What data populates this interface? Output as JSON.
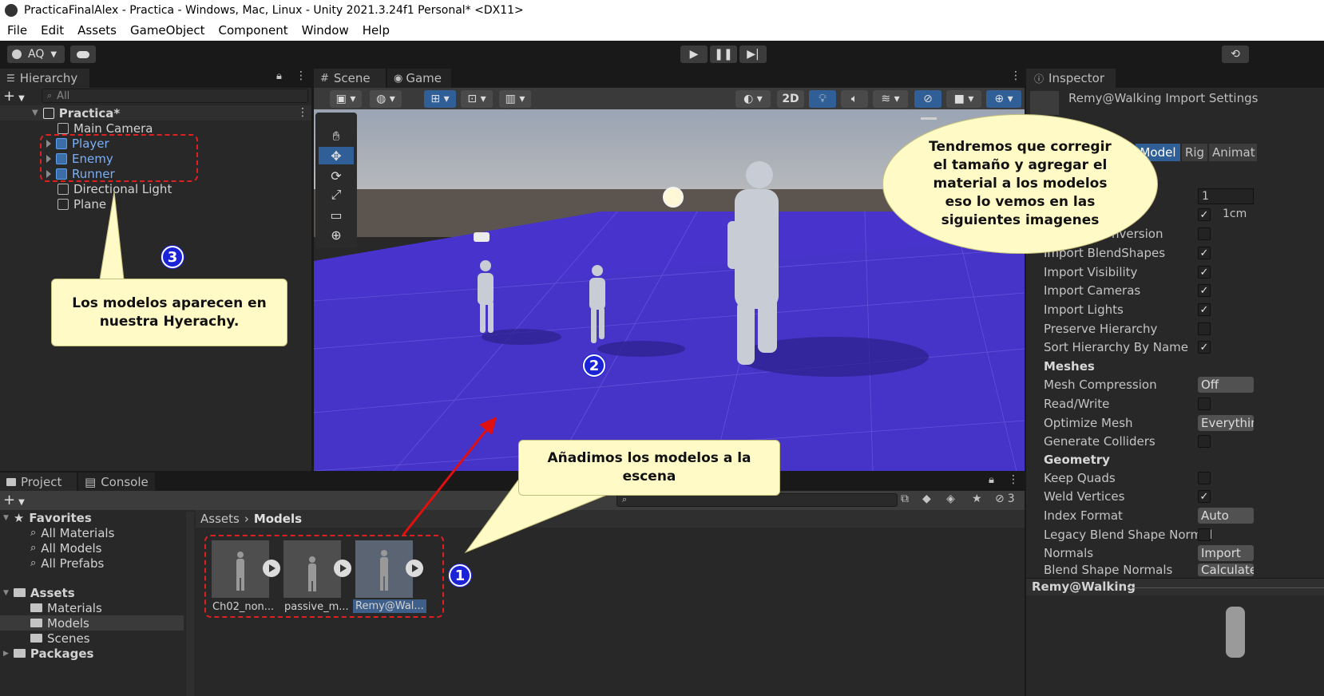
{
  "window": {
    "title": "PracticaFinalAlex - Practica - Windows, Mac, Linux - Unity 2021.3.24f1 Personal* <DX11>"
  },
  "menu": [
    "File",
    "Edit",
    "Assets",
    "GameObject",
    "Component",
    "Window",
    "Help"
  ],
  "toolbar": {
    "account": "AQ"
  },
  "hierarchy": {
    "tab": "Hierarchy",
    "search_placeholder": "All",
    "scene": "Practica*",
    "items": [
      "Main Camera",
      "Player",
      "Enemy",
      "Runner",
      "Directional Light",
      "Plane"
    ]
  },
  "scene_view": {
    "tabs": [
      "Scene",
      "Game"
    ],
    "mode_2d": "2D"
  },
  "inspector": {
    "tab": "Inspector",
    "header": "Remy@Walking Import Settings",
    "subtabs": [
      "Model",
      "Rig",
      "Animat"
    ],
    "scale_value": "1",
    "unit_label": "1cm",
    "partial_row": "nversion",
    "rows": [
      {
        "label": "Import BlendShapes",
        "checked": true
      },
      {
        "label": "Import Visibility",
        "checked": true
      },
      {
        "label": "Import Cameras",
        "checked": true
      },
      {
        "label": "Import Lights",
        "checked": true
      },
      {
        "label": "Preserve Hierarchy",
        "checked": false
      },
      {
        "label": "Sort Hierarchy By Name",
        "checked": true
      }
    ],
    "meshes_header": "Meshes",
    "mesh_compression": {
      "label": "Mesh Compression",
      "value": "Off"
    },
    "read_write": {
      "label": "Read/Write",
      "checked": false
    },
    "optimize_mesh": {
      "label": "Optimize Mesh",
      "value": "Everythin"
    },
    "generate_colliders": {
      "label": "Generate Colliders",
      "checked": false
    },
    "geometry_header": "Geometry",
    "keep_quads": {
      "label": "Keep Quads",
      "checked": false
    },
    "weld_vertices": {
      "label": "Weld Vertices",
      "checked": true
    },
    "index_format": {
      "label": "Index Format",
      "value": "Auto"
    },
    "legacy_blend": {
      "label": "Legacy Blend Shape Normal",
      "checked": false
    },
    "normals": {
      "label": "Normals",
      "value": "Import"
    },
    "blend_shape_normals": {
      "label": "Blend Shape Normals",
      "value": "Calculate"
    },
    "preview_title": "Remy@Walking"
  },
  "project": {
    "tabs": [
      "Project",
      "Console"
    ],
    "hidden_count": "3",
    "breadcrumb": [
      "Assets",
      "Models"
    ],
    "favorites": {
      "label": "Favorites",
      "items": [
        "All Materials",
        "All Models",
        "All Prefabs"
      ]
    },
    "assets": {
      "label": "Assets",
      "items": [
        "Materials",
        "Models",
        "Scenes"
      ]
    },
    "packages": "Packages",
    "files": [
      "Ch02_non...",
      "passive_m...",
      "Remy@Wal..."
    ]
  },
  "callouts": {
    "top_right": "Tendremos que corregir el tamaño y agregar el material a los modelos eso lo vemos en las siguientes imagenes",
    "hierarchy": "Los modelos aparecen en nuestra Hyerachy.",
    "scene": "Añadimos los modelos a la escena",
    "num1": "1",
    "num2": "2",
    "num3": "3"
  }
}
